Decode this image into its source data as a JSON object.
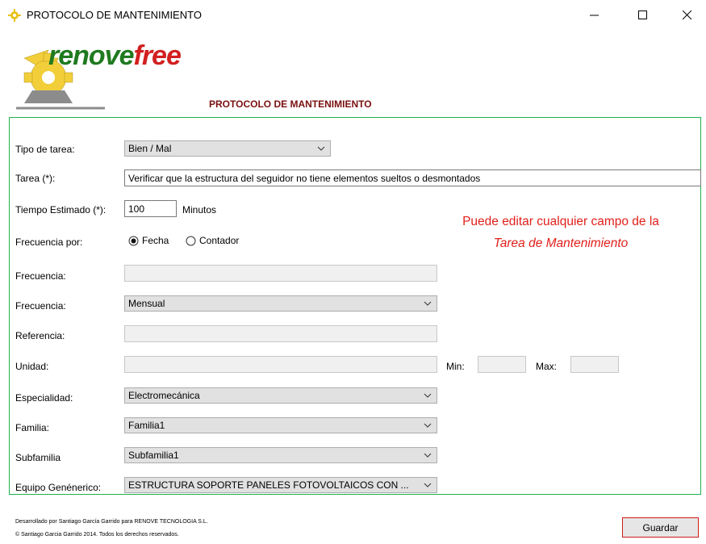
{
  "window": {
    "title": "PROTOCOLO DE MANTENIMIENTO",
    "icon": "gear-app-icon",
    "minimize_icon": "minimize-icon",
    "maximize_icon": "maximize-icon",
    "close_icon": "close-icon"
  },
  "brand": {
    "logo_text_a": "renove",
    "logo_text_b": "free",
    "color_a": "#1f7a1f",
    "color_b": "#d21f1f"
  },
  "header": {
    "subtitle": "PROTOCOLO DE MANTENIMIENTO"
  },
  "form": {
    "tipo_tarea": {
      "label": "Tipo de tarea:",
      "value": "Bien / Mal"
    },
    "tarea": {
      "label": "Tarea (*):",
      "value": "Verificar que la estructura del seguidor no tiene elementos sueltos o desmontados"
    },
    "tiempo": {
      "label": "Tiempo Estimado (*):",
      "value": "100",
      "unit": "Minutos"
    },
    "frecuencia_por": {
      "label": "Frecuencia por:",
      "options": [
        "Fecha",
        "Contador"
      ],
      "selected": "Fecha"
    },
    "frecuencia_num": {
      "label": "Frecuencia:",
      "value": ""
    },
    "frecuencia_sel": {
      "label": "Frecuencia:",
      "value": "Mensual"
    },
    "referencia": {
      "label": "Referencia:",
      "value": ""
    },
    "unidad": {
      "label": "Unidad:",
      "value": "",
      "min_label": "Min:",
      "max_label": "Max:",
      "min": "",
      "max": ""
    },
    "especialidad": {
      "label": "Especialidad:",
      "value": "Electromecánica"
    },
    "familia": {
      "label": "Familia:",
      "value": "Familia1"
    },
    "subfamilia": {
      "label": "Subfamilia",
      "value": "Subfamilia1"
    },
    "equipo": {
      "label": "Equipo Genénerico:",
      "value": "ESTRUCTURA SOPORTE PANELES FOTOVOLTAICOS CON ..."
    }
  },
  "note": {
    "line1": "Puede editar cualquier campo de la",
    "line2": "Tarea de Mantenimiento",
    "color": "#e0201b"
  },
  "footer": {
    "line1": "Desarrollado por Santiago García Garrido para RENOVE TECNOLOGIA S.L.",
    "line2": "© Santiago Garcia Garrido 2014. Todos los derechos reservados."
  },
  "actions": {
    "save_label": "Guardar"
  }
}
